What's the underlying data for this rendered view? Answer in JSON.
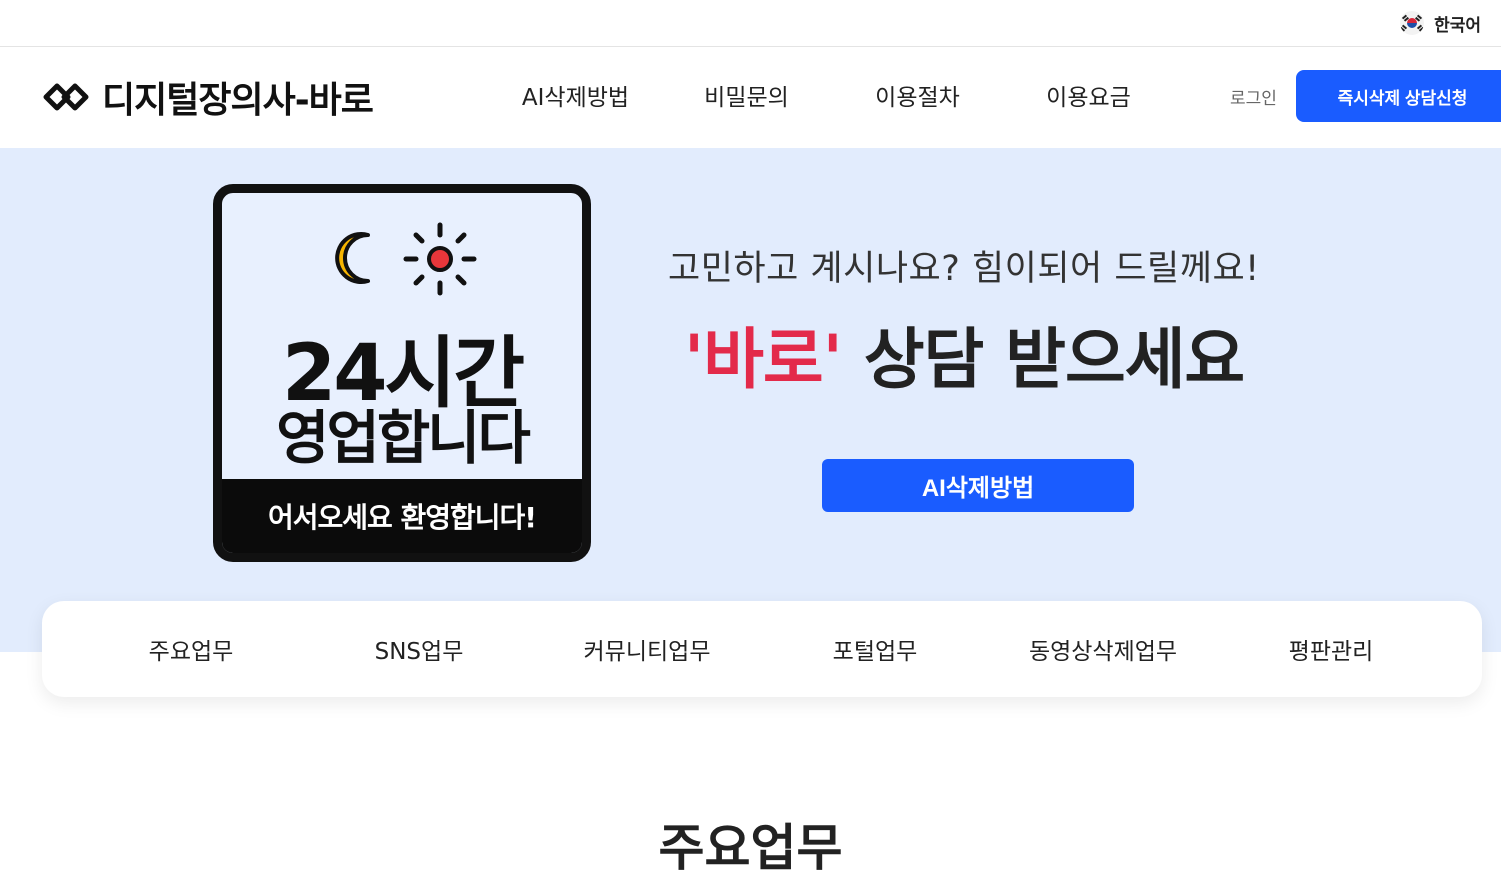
{
  "language": {
    "label": "한국어",
    "flag_icon": "korea-flag-icon"
  },
  "header": {
    "logo_text": "디지털장의사-바로",
    "logo_icon": "chain-link-icon",
    "nav": [
      "AI삭제방법",
      "비밀문의",
      "이용절차",
      "이용요금"
    ],
    "login_label": "로그인",
    "cta_label": "즉시삭제 상담신청"
  },
  "hero": {
    "sign": {
      "icons": [
        "moon-icon",
        "sun-icon"
      ],
      "line1": "24시간",
      "line2": "영업합니다",
      "footer": "어서오세요 환영합니다!"
    },
    "subtitle": "고민하고 계시나요? 힘이되어 드릴께요!",
    "title_accent": "'바로'",
    "title_rest": " 상담 받으세요",
    "button_label": "AI삭제방법"
  },
  "categories": [
    "주요업무",
    "SNS업무",
    "커뮤니티업무",
    "포털업무",
    "동영상삭제업무",
    "평판관리"
  ],
  "section_title": "주요업무",
  "colors": {
    "primary": "#1a5cff",
    "accent": "#e32a4a",
    "hero_bg": "#e2ecfd",
    "moon": "#f7b500",
    "sun_core": "#e8363a"
  }
}
